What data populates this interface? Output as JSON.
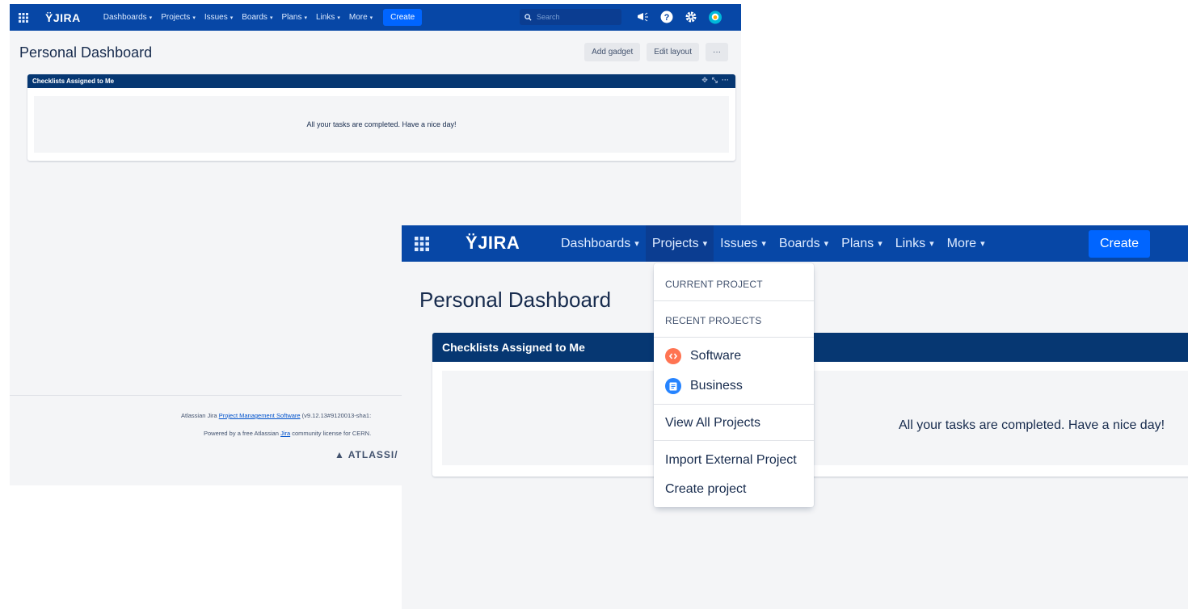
{
  "nav": {
    "logo": "JIRA",
    "items": [
      {
        "label": "Dashboards"
      },
      {
        "label": "Projects"
      },
      {
        "label": "Issues"
      },
      {
        "label": "Boards"
      },
      {
        "label": "Plans"
      },
      {
        "label": "Links"
      },
      {
        "label": "More"
      }
    ],
    "create_label": "Create",
    "search_placeholder": "Search",
    "chevron": "▾"
  },
  "page": {
    "title": "Personal Dashboard",
    "actions": {
      "add_gadget": "Add gadget",
      "edit_layout": "Edit layout",
      "more": "···"
    }
  },
  "gadget": {
    "title": "Checklists Assigned to Me",
    "message": "All your tasks are completed. Have a nice day!"
  },
  "footer": {
    "line1_prefix": "Atlassian Jira ",
    "line1_link": "Project Management Software",
    "line1_suffix": " (v9.12.13#9120013-sha1:",
    "line2_prefix": "Powered by a free Atlassian ",
    "line2_link": "Jira",
    "line2_suffix": " community license for CERN.",
    "logo_text": "ATLASSI/"
  },
  "projects_dropdown": {
    "current_header": "CURRENT PROJECT",
    "recent_header": "RECENT PROJECTS",
    "recent": [
      {
        "label": "Software",
        "icon": "software-project-icon",
        "color": "#ff7452"
      },
      {
        "label": "Business",
        "icon": "business-project-icon",
        "color": "#2684ff"
      }
    ],
    "view_all": "View All Projects",
    "import": "Import External Project",
    "create": "Create project"
  },
  "colors": {
    "nav_bg": "#0747a6",
    "create_bg": "#0065ff",
    "gadget_header": "#063772",
    "page_bg": "#f4f5f7"
  }
}
